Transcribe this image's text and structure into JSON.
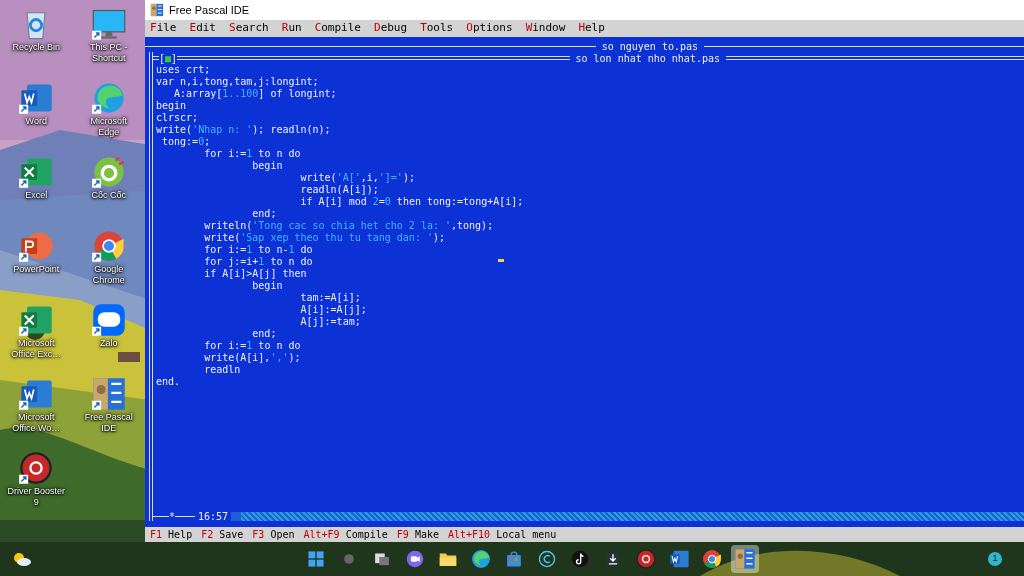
{
  "desktop_icons": [
    {
      "label": "Recycle Bin",
      "kind": "recycle"
    },
    {
      "label": "This PC - Shortcut",
      "kind": "monitor"
    },
    {
      "label": "Word",
      "kind": "word"
    },
    {
      "label": "Microsoft Edge",
      "kind": "edge"
    },
    {
      "label": "Excel",
      "kind": "excel"
    },
    {
      "label": "Cốc Cốc",
      "kind": "coccoc"
    },
    {
      "label": "PowerPoint",
      "kind": "powerpoint"
    },
    {
      "label": "Google Chrome",
      "kind": "chrome"
    },
    {
      "label": "Microsoft Office Exc…",
      "kind": "excel"
    },
    {
      "label": "Zalo",
      "kind": "zalo"
    },
    {
      "label": "Microsoft Office Wo…",
      "kind": "word"
    },
    {
      "label": "Free Pascal IDE",
      "kind": "fpc"
    },
    {
      "label": "Driver Booster 9",
      "kind": "booster"
    }
  ],
  "window": {
    "title": "Free Pascal IDE"
  },
  "menu": [
    {
      "hotkey": "F",
      "rest": "ile"
    },
    {
      "hotkey": "E",
      "rest": "dit"
    },
    {
      "hotkey": "S",
      "rest": "earch"
    },
    {
      "hotkey": "R",
      "rest": "un"
    },
    {
      "hotkey": "C",
      "rest": "ompile"
    },
    {
      "hotkey": "D",
      "rest": "ebug"
    },
    {
      "hotkey": "T",
      "rest": "ools"
    },
    {
      "hotkey": "O",
      "rest": "ptions"
    },
    {
      "hotkey": "W",
      "rest": "indow"
    },
    {
      "hotkey": "H",
      "rest": "elp"
    }
  ],
  "background_editor": {
    "title": "so nguyen to.pas"
  },
  "editor": {
    "title": "so lon nhat nho nhat.pas",
    "close_box": "[■]",
    "modified_marker": "*",
    "position": "16:57",
    "lines": [
      [
        {
          "text": "uses crt;",
          "kind": "code"
        }
      ],
      [
        {
          "text": "var n,i,tong,tam,j:longint;",
          "kind": "code"
        }
      ],
      [
        {
          "text": "   A:array[",
          "kind": "code"
        },
        {
          "text": "1..100",
          "kind": "literal"
        },
        {
          "text": "] of longint;",
          "kind": "code"
        }
      ],
      [
        {
          "text": "begin",
          "kind": "code"
        }
      ],
      [
        {
          "text": "clrscr;",
          "kind": "code"
        }
      ],
      [
        {
          "text": "write(",
          "kind": "code"
        },
        {
          "text": "'Nhap n: '",
          "kind": "literal"
        },
        {
          "text": "); readln(n);",
          "kind": "code"
        }
      ],
      [
        {
          "text": " tong:=",
          "kind": "code"
        },
        {
          "text": "0",
          "kind": "literal"
        },
        {
          "text": ";",
          "kind": "code"
        }
      ],
      [
        {
          "text": "        for i:=",
          "kind": "code"
        },
        {
          "text": "1",
          "kind": "literal"
        },
        {
          "text": " to n do",
          "kind": "code"
        }
      ],
      [
        {
          "text": "                begin",
          "kind": "code"
        }
      ],
      [
        {
          "text": "                        write(",
          "kind": "code"
        },
        {
          "text": "'A['",
          "kind": "literal"
        },
        {
          "text": ",i,",
          "kind": "code"
        },
        {
          "text": "']='",
          "kind": "literal"
        },
        {
          "text": ");",
          "kind": "code"
        }
      ],
      [
        {
          "text": "                        readln(A[i]);",
          "kind": "code"
        }
      ],
      [
        {
          "text": "                        if A[i] mod ",
          "kind": "code"
        },
        {
          "text": "2",
          "kind": "literal"
        },
        {
          "text": "=",
          "kind": "code"
        },
        {
          "text": "0",
          "kind": "literal"
        },
        {
          "text": " then tong:=tong+A[i];",
          "kind": "code"
        }
      ],
      [
        {
          "text": "                end;",
          "kind": "code"
        }
      ],
      [
        {
          "text": "        writeln(",
          "kind": "code"
        },
        {
          "text": "'Tong cac so chia het cho 2 la: '",
          "kind": "literal"
        },
        {
          "text": ",tong);",
          "kind": "code"
        }
      ],
      [
        {
          "text": "        write(",
          "kind": "code"
        },
        {
          "text": "'Sap xep theo thu tu tang dan: '",
          "kind": "literal"
        },
        {
          "text": ");",
          "kind": "code"
        }
      ],
      [
        {
          "text": "        for i:=",
          "kind": "code"
        },
        {
          "text": "1",
          "kind": "literal"
        },
        {
          "text": " to n-",
          "kind": "code"
        },
        {
          "text": "1",
          "kind": "literal"
        },
        {
          "text": " do",
          "kind": "code"
        }
      ],
      [
        {
          "text": "        for j:=i+",
          "kind": "code"
        },
        {
          "text": "1",
          "kind": "literal"
        },
        {
          "text": " to n do",
          "kind": "code"
        }
      ],
      [
        {
          "text": "        if A[i]>A[j] then",
          "kind": "code"
        }
      ],
      [
        {
          "text": "                begin",
          "kind": "code"
        }
      ],
      [
        {
          "text": "                        tam:=A[i];",
          "kind": "code"
        }
      ],
      [
        {
          "text": "                        A[i]:=A[j];",
          "kind": "code"
        }
      ],
      [
        {
          "text": "                        A[j]:=tam;",
          "kind": "code"
        }
      ],
      [
        {
          "text": "                end;",
          "kind": "code"
        }
      ],
      [
        {
          "text": "        for i:=",
          "kind": "code"
        },
        {
          "text": "1",
          "kind": "literal"
        },
        {
          "text": " to n do",
          "kind": "code"
        }
      ],
      [
        {
          "text": "        write(A[i],",
          "kind": "code"
        },
        {
          "text": "','",
          "kind": "literal"
        },
        {
          "text": ");",
          "kind": "code"
        }
      ],
      [
        {
          "text": "        readln",
          "kind": "code"
        }
      ],
      [
        {
          "text": "end.",
          "kind": "code"
        }
      ]
    ]
  },
  "status_bar": [
    {
      "key": "F1",
      "label": "Help"
    },
    {
      "key": "F2",
      "label": "Save"
    },
    {
      "key": "F3",
      "label": "Open"
    },
    {
      "key": "Alt+F9",
      "label": "Compile"
    },
    {
      "key": "F9",
      "label": "Make"
    },
    {
      "key": "Alt+F10",
      "label": "Local menu"
    }
  ],
  "taskbar": {
    "apps": [
      {
        "kind": "start",
        "selected": false
      },
      {
        "kind": "search",
        "selected": false
      },
      {
        "kind": "taskview",
        "selected": false
      },
      {
        "kind": "meet",
        "selected": false
      },
      {
        "kind": "folder",
        "selected": false
      },
      {
        "kind": "edge",
        "selected": false
      },
      {
        "kind": "store",
        "selected": false
      },
      {
        "kind": "ccleaner",
        "selected": false
      },
      {
        "kind": "tiktok",
        "selected": false
      },
      {
        "kind": "download",
        "selected": false
      },
      {
        "kind": "booster",
        "selected": false
      },
      {
        "kind": "word",
        "selected": false
      },
      {
        "kind": "chrome",
        "selected": false
      },
      {
        "kind": "fpc",
        "selected": true
      }
    ],
    "notification_count": "1"
  }
}
